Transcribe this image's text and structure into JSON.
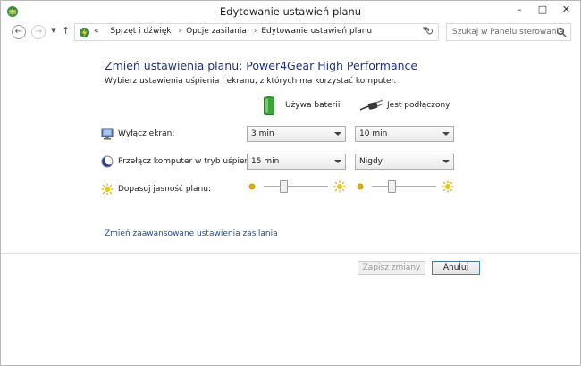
{
  "window": {
    "title": "Edytowanie ustawień planu",
    "controls": {
      "minimize": "–",
      "maximize": "□",
      "close": "✕"
    }
  },
  "nav": {
    "back": "←",
    "forward": "→",
    "up": "↑",
    "refresh": "↻",
    "overflow": "«",
    "breadcrumbs": [
      "Sprzęt i dźwięk",
      "Opcje zasilania",
      "Edytowanie ustawień planu"
    ],
    "search_placeholder": "Szukaj w Panelu sterowania"
  },
  "main": {
    "heading": "Zmień ustawienia planu: Power4Gear High Performance",
    "subheading": "Wybierz ustawienia uśpienia i ekranu, z których ma korzystać komputer.",
    "columns": {
      "battery": "Używa baterii",
      "plugged": "Jest podłączony"
    },
    "rows": {
      "display_off": {
        "label": "Wyłącz ekran:",
        "battery": "3 min",
        "plugged": "10 min"
      },
      "sleep": {
        "label": "Przełącz komputer w tryb uśpienia:",
        "battery": "15 min",
        "plugged": "Nigdy"
      },
      "brightness": {
        "label": "Dopasuj jasność planu:",
        "battery_level": 0.3,
        "plugged_level": 0.3
      }
    },
    "advanced_link": "Zmień zaawansowane ustawienia zasilania"
  },
  "footer": {
    "save_label": "Zapisz zmiany",
    "save_enabled": false,
    "cancel_label": "Anuluj"
  },
  "colors": {
    "heading": "#1e3287",
    "link": "#1e4fa0",
    "battery_green": "#3aa63a",
    "sun": "#e0a800"
  },
  "icons": [
    "power-options-icon",
    "battery-icon",
    "plug-icon",
    "monitor-icon",
    "moon-icon",
    "sun-icon",
    "search-icon",
    "refresh-icon"
  ]
}
